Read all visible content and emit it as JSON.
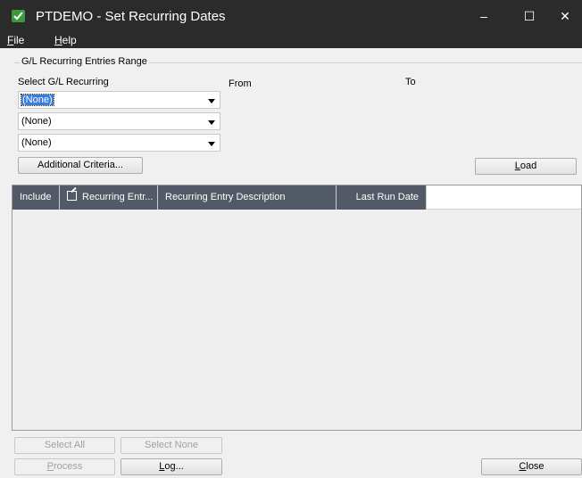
{
  "window": {
    "title": "PTDEMO - Set Recurring Dates",
    "min": "–",
    "max": "☐",
    "close": "✕",
    "icon": "app-icon"
  },
  "menu": {
    "file": {
      "accel": "F",
      "rest": "ile"
    },
    "help": {
      "accel": "H",
      "rest": "elp"
    }
  },
  "range": {
    "legend": "G/L Recurring Entries Range",
    "select_label": "Select G/L Recurring",
    "from_label": "From",
    "to_label": "To",
    "combos": [
      "(None)",
      "(None)",
      "(None)"
    ],
    "additional_criteria": "Additional Criteria...",
    "load": {
      "accel": "L",
      "rest": "oad"
    }
  },
  "grid": {
    "columns": [
      "Include",
      "Recurring Entr...",
      "Recurring Entry Description",
      "Last Run Date"
    ]
  },
  "footer": {
    "select_all": "Select All",
    "select_none": "Select None",
    "process": {
      "accel": "P",
      "rest": "rocess"
    },
    "log": {
      "accel": "L",
      "rest": "og..."
    },
    "close": {
      "accel": "C",
      "rest": "lose"
    }
  }
}
